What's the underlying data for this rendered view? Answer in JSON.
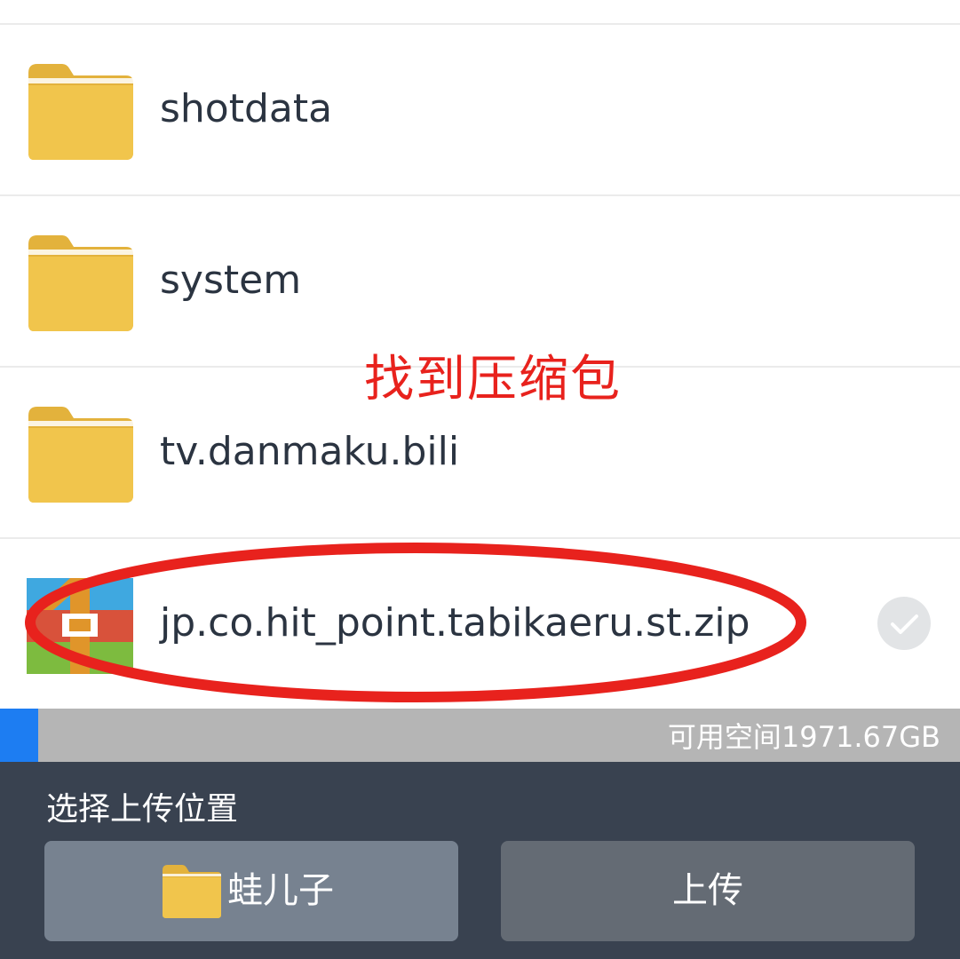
{
  "files": [
    {
      "name": "shotdata",
      "type": "folder"
    },
    {
      "name": "system",
      "type": "folder"
    },
    {
      "name": "tv.danmaku.bili",
      "type": "folder"
    },
    {
      "name": "jp.co.hit_point.tabikaeru.st.zip",
      "type": "zip",
      "selected": true
    }
  ],
  "annotation": {
    "text": "找到压缩包",
    "color": "#e8221d"
  },
  "storage": {
    "text": "可用空间1971.67GB",
    "used_fraction": 0.04
  },
  "bottom": {
    "title": "选择上传位置",
    "folder_button": "蛙儿子",
    "upload_button": "上传"
  },
  "colors": {
    "folder": "#f1c54c",
    "accent": "#1d7df2",
    "panel": "#394250"
  },
  "icons": [
    "folder-icon",
    "zip-archive-icon",
    "check-circle-icon"
  ]
}
